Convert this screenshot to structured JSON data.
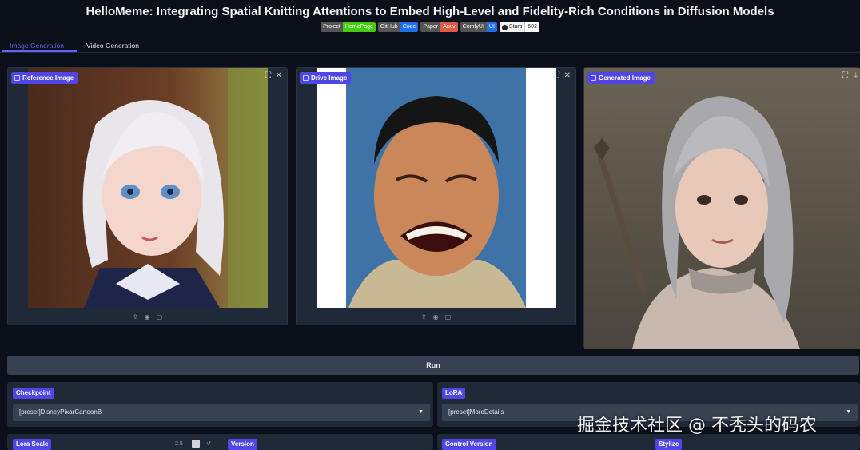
{
  "title": "HelloMeme: Integrating Spatial Knitting Attentions to Embed High-Level and Fidelity-Rich Conditions in Diffusion Models",
  "badges": [
    {
      "left": "Project",
      "right": "HomePage",
      "color": "#4c1"
    },
    {
      "left": "GitHub",
      "right": "Code",
      "color": "#1f6feb"
    },
    {
      "left": "Paper",
      "right": "Arxiv",
      "color": "#e05d44"
    },
    {
      "left": "ComfyUI",
      "right": "UI",
      "color": "#1f6feb"
    },
    {
      "left": "Stars",
      "right": "602",
      "color": "#ffffff"
    }
  ],
  "tabs": {
    "image": "Image Generation",
    "video": "Video Generation"
  },
  "panels": {
    "reference": "Reference Image",
    "drive": "Drive Image",
    "generated": "Generated Image"
  },
  "icons": {
    "upload": "upload-icon",
    "webcam": "webcam-icon",
    "clipboard": "clipboard-icon",
    "fullscreen": "fullscreen-icon",
    "close": "close-icon",
    "download": "download-icon"
  },
  "run_label": "Run",
  "settings": {
    "checkpoint_label": "Checkpoint",
    "checkpoint_value": "[preset]DisneyPixarCartoonB",
    "lora_label": "LoRA",
    "lora_value": "[preset]MoreDetails",
    "lora_scale_label": "Lora Scale",
    "lora_scale_value": "2.5",
    "version_label": "Version",
    "control_version_label": "Control Version",
    "stylize_label": "Stylize"
  },
  "watermark": "掘金技术社区 @ 不秃头的码农",
  "colors": {
    "accent": "#4f46e5",
    "background": "#0b0f19",
    "panel": "#1f2937"
  }
}
